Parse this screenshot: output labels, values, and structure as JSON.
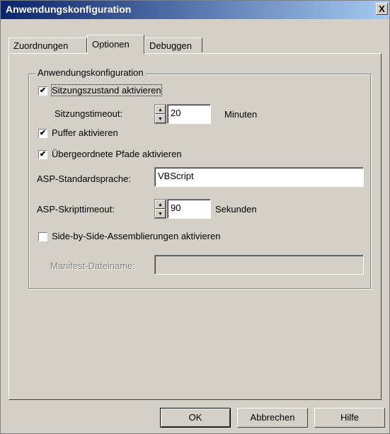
{
  "window": {
    "title": "Anwendungskonfiguration",
    "close_label": "X"
  },
  "tabs": [
    {
      "label": "Zuordnungen"
    },
    {
      "label": "Optionen"
    },
    {
      "label": "Debuggen"
    }
  ],
  "group": {
    "title": "Anwendungskonfiguration",
    "session_state": {
      "label": "Sitzungszustand aktivieren",
      "checked_mark": "✔"
    },
    "session_timeout": {
      "label": "Sitzungstimeout:",
      "value": "20",
      "unit": "Minuten"
    },
    "buffer": {
      "label": "Puffer aktivieren",
      "checked_mark": "✔"
    },
    "parent_paths": {
      "label": "Übergeordnete Pfade aktivieren",
      "checked_mark": "✔"
    },
    "asp_language": {
      "label": "ASP-Standardsprache:",
      "value": "VBScript"
    },
    "asp_timeout": {
      "label": "ASP-Skripttimeout:",
      "value": "90",
      "unit": "Sekunden"
    },
    "side_by_side": {
      "label": "Side-by-Side-Assemblierungen aktivieren",
      "checked_mark": ""
    },
    "manifest": {
      "label": "Manifest-Dateiname:",
      "value": ""
    }
  },
  "spin_arrows": {
    "up": "▲",
    "down": "▼"
  },
  "buttons": {
    "ok": "OK",
    "cancel": "Abbrechen",
    "help": "Hilfe"
  }
}
